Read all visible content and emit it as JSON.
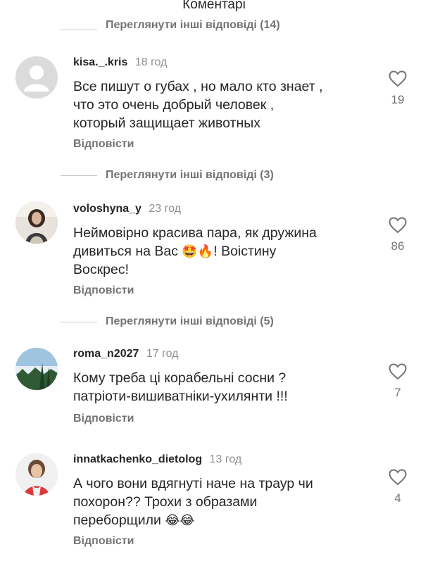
{
  "header": {
    "title": "Коментарі"
  },
  "top_more_replies": "Переглянути інші відповіді (14)",
  "comments": [
    {
      "username": "kisa._.kris",
      "time": "18 год",
      "text_lines": [
        "Все пишут о губах , но мало кто знает ,",
        "что это очень добрый человек ,",
        "который защищает животных"
      ],
      "reply": "Відповісти",
      "likes": "19",
      "more_replies": "Переглянути інші відповіді (3)"
    },
    {
      "username": "voloshyna_y",
      "time": "23 год",
      "text_lines": [
        "Неймовірно красива пара, як дружина",
        "дивиться на Вас",
        "! Воістину",
        "Воскрес!"
      ],
      "emoji": "🤩🔥",
      "reply": "Відповісти",
      "likes": "86",
      "more_replies": "Переглянути інші відповіді (5)"
    },
    {
      "username": "roma_n2027",
      "time": "17 год",
      "text_lines": [
        "Кому треба ці корабельні сосни ?",
        "патріоти-вишиватніки-ухилянти !!!"
      ],
      "reply": "Відповісти",
      "likes": "7"
    },
    {
      "username": "innatkachenko_dietolog",
      "time": "13 год",
      "text_lines": [
        "А чого вони вдягнуті наче на траур чи",
        "похорон?? Трохи з образами",
        "переборщили"
      ],
      "emoji": "😂😂",
      "reply": "Відповісти",
      "likes": "4"
    }
  ],
  "icons": {
    "like": "heart-outline-icon"
  }
}
